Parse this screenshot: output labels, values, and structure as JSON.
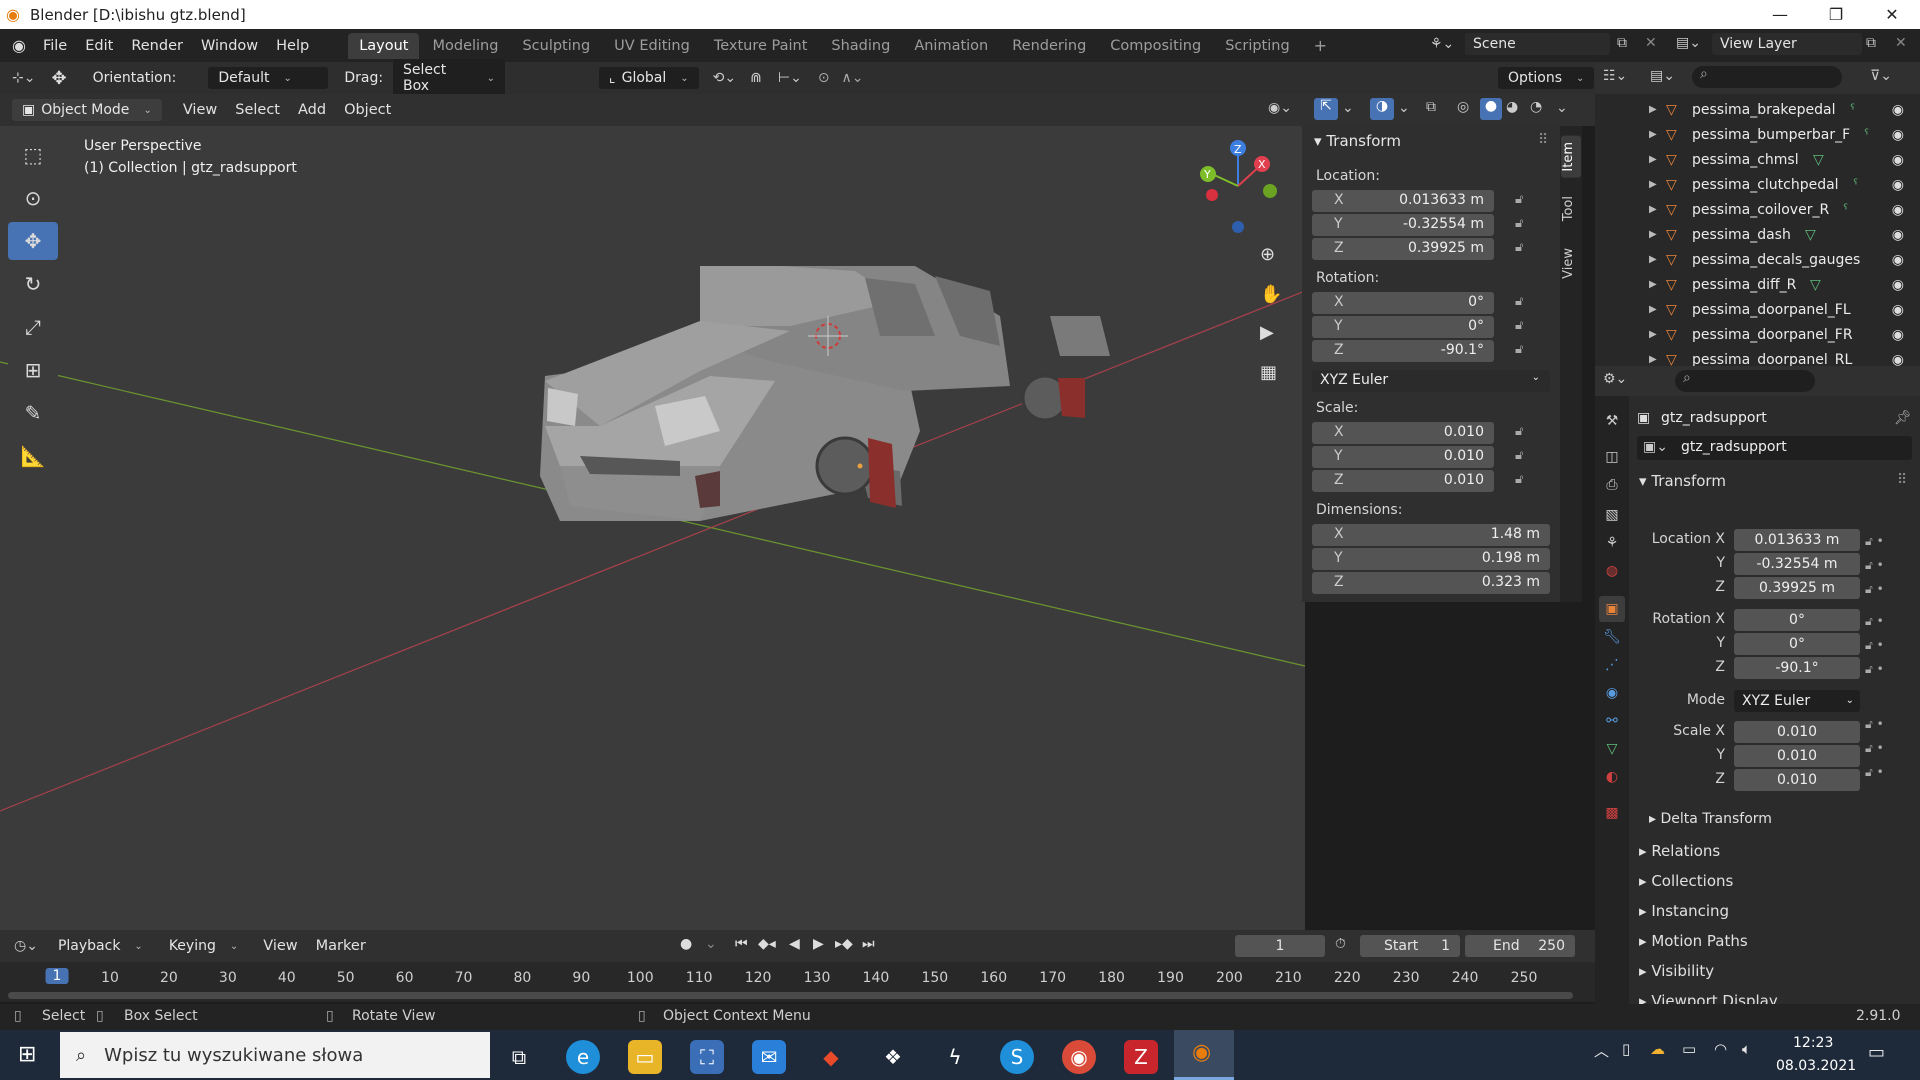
{
  "window": {
    "title": "Blender [D:\\ibishu gtz.blend]",
    "controls": [
      "—",
      "❐",
      "✕"
    ]
  },
  "menu": [
    "File",
    "Edit",
    "Render",
    "Window",
    "Help"
  ],
  "workspaces": [
    "Layout",
    "Modeling",
    "Sculpting",
    "UV Editing",
    "Texture Paint",
    "Shading",
    "Animation",
    "Rendering",
    "Compositing",
    "Scripting"
  ],
  "active_workspace": "Layout",
  "scene": "Scene",
  "view_layer": "View Layer",
  "toolheader": {
    "orientation_label": "Orientation:",
    "orientation_value": "Default",
    "drag_label": "Drag:",
    "drag_value": "Select Box",
    "transform_orient": "Global",
    "options": "Options"
  },
  "vpheader": {
    "mode": "Object Mode",
    "menus": [
      "View",
      "Select",
      "Add",
      "Object"
    ]
  },
  "viewport": {
    "perspective": "User Perspective",
    "collection": "(1) Collection | gtz_radsupport"
  },
  "npanel": {
    "section": "Transform",
    "location_label": "Location:",
    "location": {
      "x": "0.013633 m",
      "y": "-0.32554 m",
      "z": "0.39925 m"
    },
    "rotation_label": "Rotation:",
    "rotation": {
      "x": "0°",
      "y": "0°",
      "z": "-90.1°"
    },
    "rotation_mode": "XYZ Euler",
    "scale_label": "Scale:",
    "scale": {
      "x": "0.010",
      "y": "0.010",
      "z": "0.010"
    },
    "dimensions_label": "Dimensions:",
    "dimensions": {
      "x": "1.48 m",
      "y": "0.198 m",
      "z": "0.323 m"
    },
    "tabs": [
      "Item",
      "Tool",
      "View"
    ]
  },
  "outliner": {
    "items": [
      {
        "name": "pessima_brakepedal",
        "data": "ˁ"
      },
      {
        "name": "pessima_bumperbar_F",
        "data": "ˁ"
      },
      {
        "name": "pessima_chmsl",
        "data": "▽"
      },
      {
        "name": "pessima_clutchpedal",
        "data": "ˁ"
      },
      {
        "name": "pessima_coilover_R",
        "data": "ˁ"
      },
      {
        "name": "pessima_dash",
        "data": "▽"
      },
      {
        "name": "pessima_decals_gauges",
        "data": ""
      },
      {
        "name": "pessima_diff_R",
        "data": "▽"
      },
      {
        "name": "pessima_doorpanel_FL",
        "data": ""
      },
      {
        "name": "pessima_doorpanel_FR",
        "data": ""
      },
      {
        "name": "pessima_doorpanel_RL",
        "data": ""
      }
    ]
  },
  "properties": {
    "object_name": "gtz_radsupport",
    "datablock": "gtz_radsupport",
    "section": "Transform",
    "location_x_label": "Location X",
    "rotation_x_label": "Rotation X",
    "mode_label": "Mode",
    "scale_x_label": "Scale X",
    "y_label": "Y",
    "z_label": "Z",
    "location": [
      "0.013633 m",
      "-0.32554 m",
      "0.39925 m"
    ],
    "rotation": [
      "0°",
      "0°",
      "-90.1°"
    ],
    "mode": "XYZ Euler",
    "scale": [
      "0.010",
      "0.010",
      "0.010"
    ],
    "subsections": [
      "Delta Transform"
    ],
    "collapsed": [
      "Relations",
      "Collections",
      "Instancing",
      "Motion Paths",
      "Visibility",
      "Viewport Display"
    ]
  },
  "timeline": {
    "menus": [
      "Playback",
      "Keying",
      "View",
      "Marker"
    ],
    "current_frame": "1",
    "start_label": "Start",
    "start": "1",
    "end_label": "End",
    "end": "250",
    "ruler": [
      "1",
      "10",
      "20",
      "30",
      "40",
      "50",
      "60",
      "70",
      "80",
      "90",
      "100",
      "110",
      "120",
      "130",
      "140",
      "150",
      "160",
      "170",
      "180",
      "190",
      "200",
      "210",
      "220",
      "230",
      "240",
      "250"
    ]
  },
  "statusbar": {
    "select": "Select",
    "box_select": "Box Select",
    "rotate": "Rotate View",
    "context": "Object Context Menu",
    "version": "2.91.0"
  },
  "taskbar": {
    "search_placeholder": "Wpisz tu wyszukiwane słowa",
    "time": "12:23",
    "date": "08.03.2021"
  },
  "colors": {
    "accent": "#4772b3",
    "mesh": "#e8833a",
    "x_axis": "#e0404e",
    "y_axis": "#7ebd2a",
    "z_axis": "#3d7fe0"
  }
}
